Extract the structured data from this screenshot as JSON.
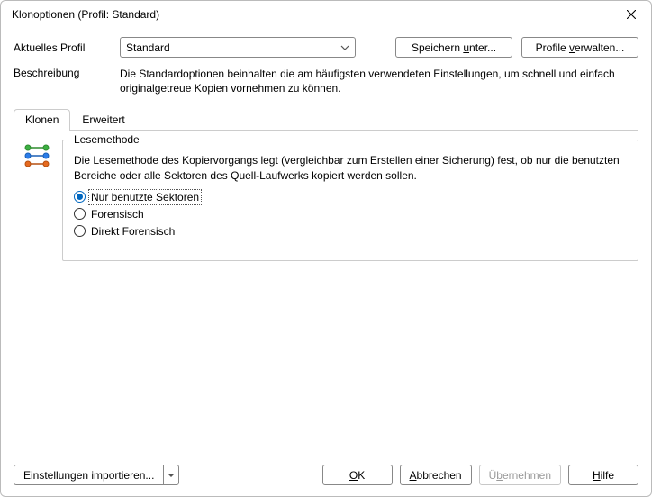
{
  "titlebar": {
    "title": "Klonoptionen (Profil: Standard)"
  },
  "profile_row": {
    "label": "Aktuelles Profil",
    "selected": "Standard",
    "save_as": "Speichern unter...",
    "manage": "Profile verwalten..."
  },
  "description_row": {
    "label": "Beschreibung",
    "text": "Die Standardoptionen beinhalten die am häufigsten verwendeten Einstellungen, um schnell und einfach originalgetreue Kopien vornehmen zu können."
  },
  "tabs": {
    "clone": "Klonen",
    "advanced": "Erweitert"
  },
  "read_method": {
    "legend": "Lesemethode",
    "desc": "Die Lesemethode des Kopiervorgangs legt (vergleichbar zum Erstellen einer Sicherung) fest, ob nur die benutzten Bereiche oder alle Sektoren des Quell-Laufwerks kopiert werden sollen.",
    "options": {
      "used": "Nur benutzte Sektoren",
      "forensic": "Forensisch",
      "direct_forensic": "Direkt Forensisch"
    },
    "selected": "used"
  },
  "footer": {
    "import": "Einstellungen importieren...",
    "ok_pre": "",
    "ok_m": "O",
    "ok_post": "K",
    "cancel_pre": "",
    "cancel_m": "A",
    "cancel_post": "bbrechen",
    "apply_pre": "Ü",
    "apply_m": "b",
    "apply_post": "ernehmen",
    "help_pre": "",
    "help_m": "H",
    "help_post": "ilfe"
  }
}
